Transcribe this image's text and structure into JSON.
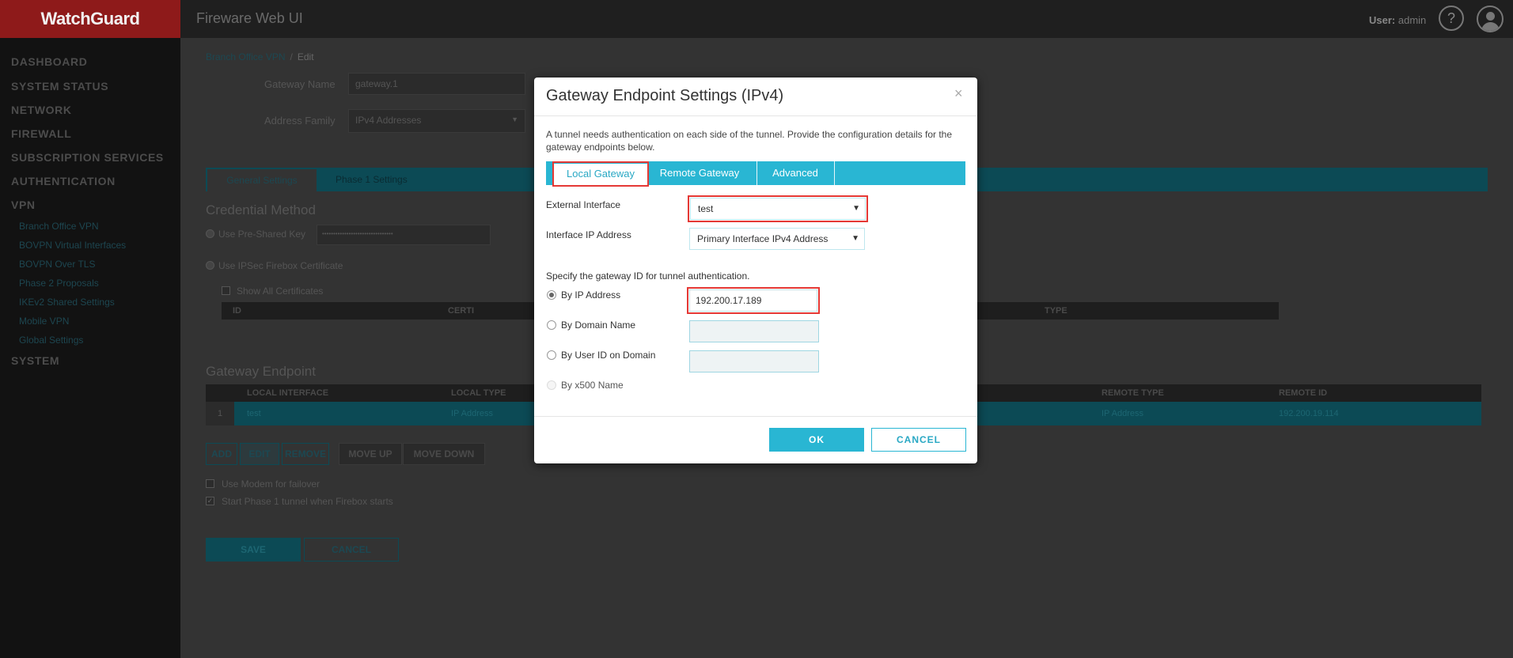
{
  "header": {
    "logo_text": "WatchGuard",
    "app_title": "Fireware Web UI",
    "user_label": "User:",
    "user_name": "admin",
    "help_glyph": "?"
  },
  "sidebar": {
    "items": [
      "DASHBOARD",
      "SYSTEM STATUS",
      "NETWORK",
      "FIREWALL",
      "SUBSCRIPTION SERVICES",
      "AUTHENTICATION",
      "VPN"
    ],
    "vpn_subitems": [
      "Branch Office VPN",
      "BOVPN Virtual Interfaces",
      "BOVPN Over TLS",
      "Phase 2 Proposals",
      "IKEv2 Shared Settings",
      "Mobile VPN",
      "Global Settings"
    ],
    "last_item": "SYSTEM"
  },
  "background": {
    "breadcrumb_parent": "Branch Office VPN",
    "breadcrumb_sep": "/",
    "breadcrumb_current": "Edit",
    "gateway_name_label": "Gateway Name",
    "gateway_name_value": "gateway.1",
    "address_family_label": "Address Family",
    "address_family_value": "IPv4 Addresses",
    "tabs": [
      "General Settings",
      "Phase 1 Settings"
    ],
    "credential_title": "Credential Method",
    "use_psk_label": "Use Pre-Shared Key",
    "psk_mask": "••••••••••••••••••••••••••••••••",
    "use_cert_label": "Use IPSec Firebox Certificate",
    "show_all_certs_label": "Show All Certificates",
    "cert_cols": [
      "ID",
      "CERTI",
      "TYPE"
    ],
    "gateway_endpoint_title": "Gateway Endpoint",
    "endpoint_cols": [
      "LOCAL INTERFACE",
      "LOCAL TYPE",
      "REMOTE TYPE",
      "REMOTE ID"
    ],
    "endpoint_row": {
      "index": "1",
      "local_interface": "test",
      "local_type": "IP Address",
      "remote_type": "IP Address",
      "remote_id": "192.200.19.114"
    },
    "buttons": [
      "ADD",
      "EDIT",
      "REMOVE",
      "MOVE UP",
      "MOVE DOWN"
    ],
    "modem_label": "Use Modem for failover",
    "start_phase1_label": "Start Phase 1 tunnel when Firebox starts",
    "save_label": "SAVE",
    "cancel_label": "CANCEL"
  },
  "modal": {
    "title": "Gateway Endpoint Settings (IPv4)",
    "close_glyph": "×",
    "description": "A tunnel needs authentication on each side of the tunnel. Provide the configuration details for the gateway endpoints below.",
    "tabs": [
      "Local Gateway",
      "Remote Gateway",
      "Advanced"
    ],
    "active_tab": "Local Gateway",
    "external_interface_label": "External Interface",
    "external_interface_value": "test",
    "interface_ip_label": "Interface IP Address",
    "interface_ip_value": "Primary Interface IPv4 Address",
    "gateway_id_prompt": "Specify the gateway ID for tunnel authentication.",
    "options": [
      {
        "label": "By IP Address",
        "checked": true,
        "value": "192.200.17.189"
      },
      {
        "label": "By Domain Name",
        "checked": false,
        "value": ""
      },
      {
        "label": "By User ID on Domain",
        "checked": false,
        "value": ""
      },
      {
        "label": "By x500 Name",
        "checked": false,
        "value": ""
      }
    ],
    "ok_label": "OK",
    "cancel_label": "CANCEL",
    "caret_glyph": "▼"
  },
  "colors": {
    "accent": "#29b6d3",
    "highlight": "#e53935",
    "logo_bg": "#8e1a1a"
  }
}
